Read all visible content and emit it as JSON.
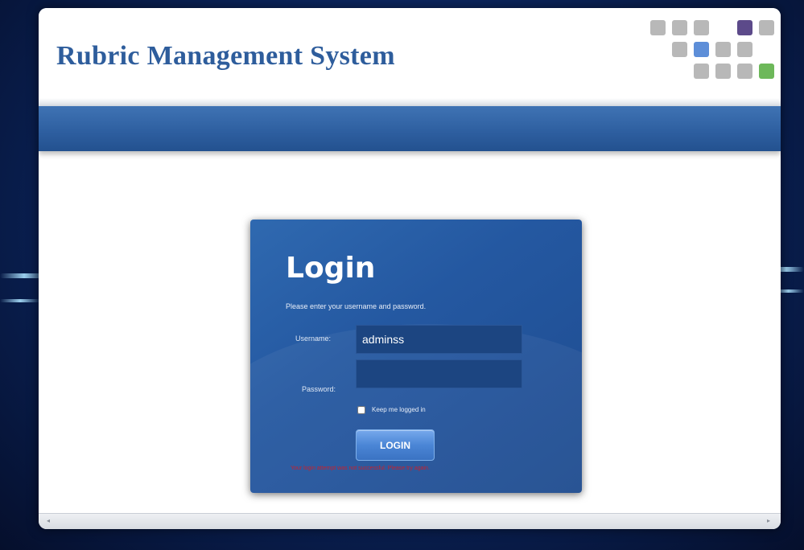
{
  "header": {
    "title": "Rubric Management System",
    "logo_colors": [
      "#b8b8b8",
      "#b8b8b8",
      "#b8b8b8",
      "#5c4a8a",
      "#b8b8b8",
      "#b8b8b8",
      "#5d8ed8",
      "#b8b8b8",
      "#b8b8b8",
      "#b8b8b8",
      "#b8b8b8",
      "#b8b8b8",
      "#6db85a"
    ]
  },
  "login": {
    "title": "Login",
    "instructions": "Please enter your username and password.",
    "username_label": "Username:",
    "username_value": "adminss",
    "password_label": "Password:",
    "password_value": "",
    "remember_label": "Keep me logged in",
    "remember_checked": false,
    "button_label": "LOGIN",
    "error_message": "Your login attempt was not successful. Please try again."
  },
  "colors": {
    "brand_blue": "#2e5d9c",
    "nav_blue": "#2d5e9f",
    "panel_blue": "#2458a1",
    "error_red": "#c8202c"
  }
}
